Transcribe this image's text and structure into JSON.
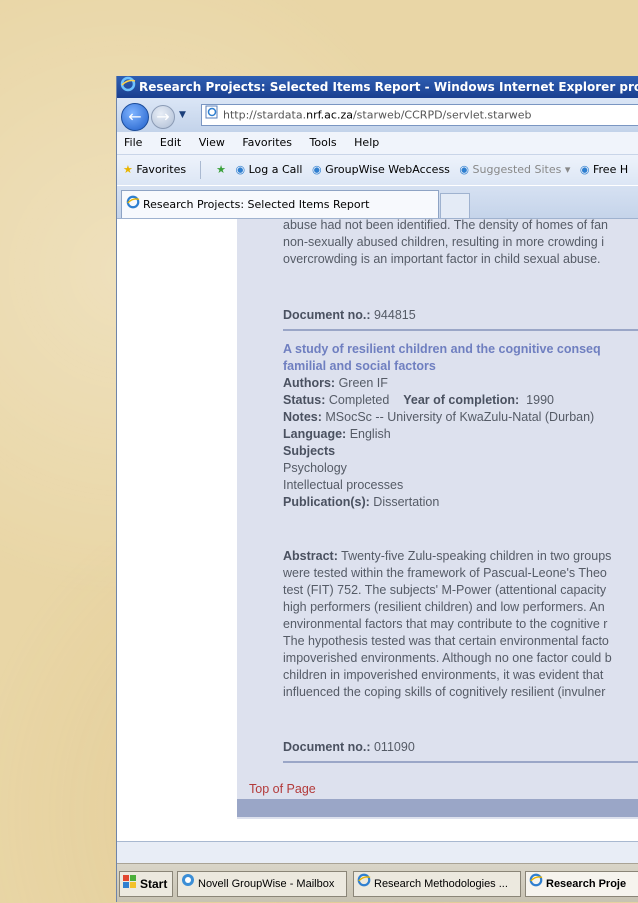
{
  "window": {
    "title": "Research Projects: Selected Items Report - Windows Internet Explorer provided by I"
  },
  "address": {
    "prefix": "http://stardata.",
    "host": "nrf.ac.za",
    "suffix": "/starweb/CCRPD/servlet.starweb"
  },
  "menu": [
    "File",
    "Edit",
    "View",
    "Favorites",
    "Tools",
    "Help"
  ],
  "favorites": {
    "favorites_label": "Favorites",
    "items": [
      "Log a Call",
      "GroupWise WebAccess",
      "Suggested Sites ▾",
      "Free H"
    ]
  },
  "tab": {
    "label": "Research Projects: Selected Items Report"
  },
  "content": {
    "prev_lines": [
      "abuse had not been identified. The density of homes of fan",
      "non-sexually abused children, resulting in more crowding i",
      "overcrowding is an important factor in child sexual abuse."
    ],
    "doc1_label": "Document no.:",
    "doc1_value": "944815",
    "record": {
      "title_line1": "A study of resilient children and the cognitive conseq",
      "title_line2": "familial and social factors",
      "authors_label": "Authors:",
      "authors_value": "Green IF",
      "status_label": "Status:",
      "status_value": "Completed",
      "year_label": "Year of completion:",
      "year_value": "1990",
      "notes_label": "Notes:",
      "notes_value": "MSocSc -- University of KwaZulu-Natal (Durban)",
      "language_label": "Language:",
      "language_value": "English",
      "subjects_label": "Subjects",
      "subjects": [
        "Psychology",
        "Intellectual processes"
      ],
      "publication_label": "Publication(s):",
      "publication_value": "Dissertation"
    },
    "abstract_label": "Abstract:",
    "abstract_lines": [
      " Twenty-five Zulu-speaking children in two groups",
      "were tested within the framework of Pascual-Leone's Theo",
      "test (FIT) 752. The subjects' M-Power (attentional capacity",
      "high performers (resilient children) and low performers. An",
      "environmental factors that may contribute to the cognitive r",
      "The hypothesis tested was that certain environmental facto",
      "impoverished environments. Although no one factor could b",
      "children in impoverished environments, it was evident that",
      "influenced the coping skills of cognitively resilient (invulner"
    ],
    "doc2_label": "Document no.:",
    "doc2_value": "011090",
    "top_link": "Top of Page"
  },
  "taskbar": {
    "start": "Start",
    "items": [
      "Novell GroupWise - Mailbox",
      "Research Methodologies ...",
      "Research Proje"
    ]
  }
}
